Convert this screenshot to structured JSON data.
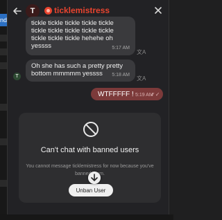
{
  "left_edge": {
    "tab_label": "nd"
  },
  "header": {
    "back_icon": "arrow-left-icon",
    "avatar_letter": "T",
    "title": "ticklemistress",
    "accent_color": "#e8442f"
  },
  "messages": [
    {
      "text": "tickle tickle tickle tickle tickle\ntickle tickle tickle tickle tickle\ntickle tickle tickle hehehe oh\nyessss",
      "time": "5:17 AM"
    },
    {
      "text": "Oh she has such a pretty pretty\nbottom mmmmm yessss",
      "time": "5:18 AM",
      "avatar_letter": "T"
    }
  ],
  "sent_message": {
    "text": "WTFFFFF !",
    "time": "5:19 AM",
    "color": "#7c3a3a"
  },
  "ban_card": {
    "title": "Can't chat with banned users",
    "description": "You cannot message ticklemistress for now because you've banned them.",
    "button_label": "Unban User"
  }
}
